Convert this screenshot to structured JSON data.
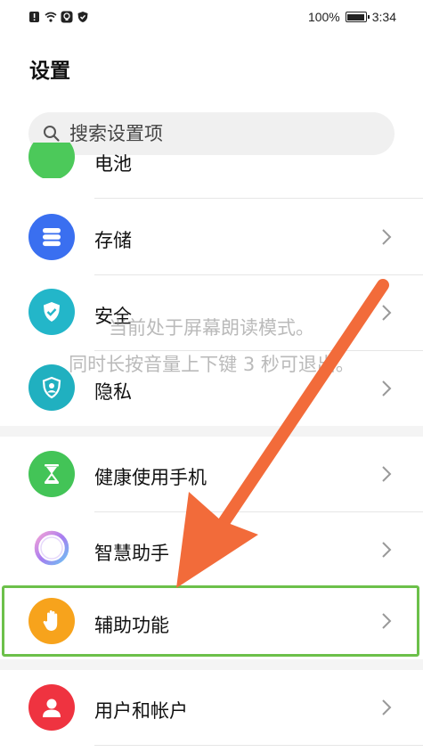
{
  "status_bar": {
    "battery": "100%",
    "time": "3:34"
  },
  "header": {
    "title": "设置"
  },
  "search": {
    "placeholder": "搜索设置项"
  },
  "items": [
    {
      "label": "电池",
      "icon": "battery-icon",
      "color": "#4cc95a"
    },
    {
      "label": "存储",
      "icon": "storage-icon",
      "color": "#3a6ff0"
    },
    {
      "label": "安全",
      "icon": "shield-icon",
      "color": "#23b6c9"
    },
    {
      "label": "隐私",
      "icon": "privacy-icon",
      "color": "#20b0c0"
    },
    {
      "label": "健康使用手机",
      "icon": "hourglass-icon",
      "color": "#43c457"
    },
    {
      "label": "智慧助手",
      "icon": "assistant-icon",
      "color": "#c9a8f5"
    },
    {
      "label": "辅助功能",
      "icon": "hand-icon",
      "color": "#f7a31c"
    },
    {
      "label": "用户和帐户",
      "icon": "user-icon",
      "color": "#ef3340"
    }
  ],
  "overlay": {
    "line1": "当前处于屏幕朗读模式。",
    "line2": "同时长按音量上下键 3 秒可退出。"
  },
  "colors": {
    "highlight": "#6cc04a",
    "arrow": "#f26b3a"
  }
}
